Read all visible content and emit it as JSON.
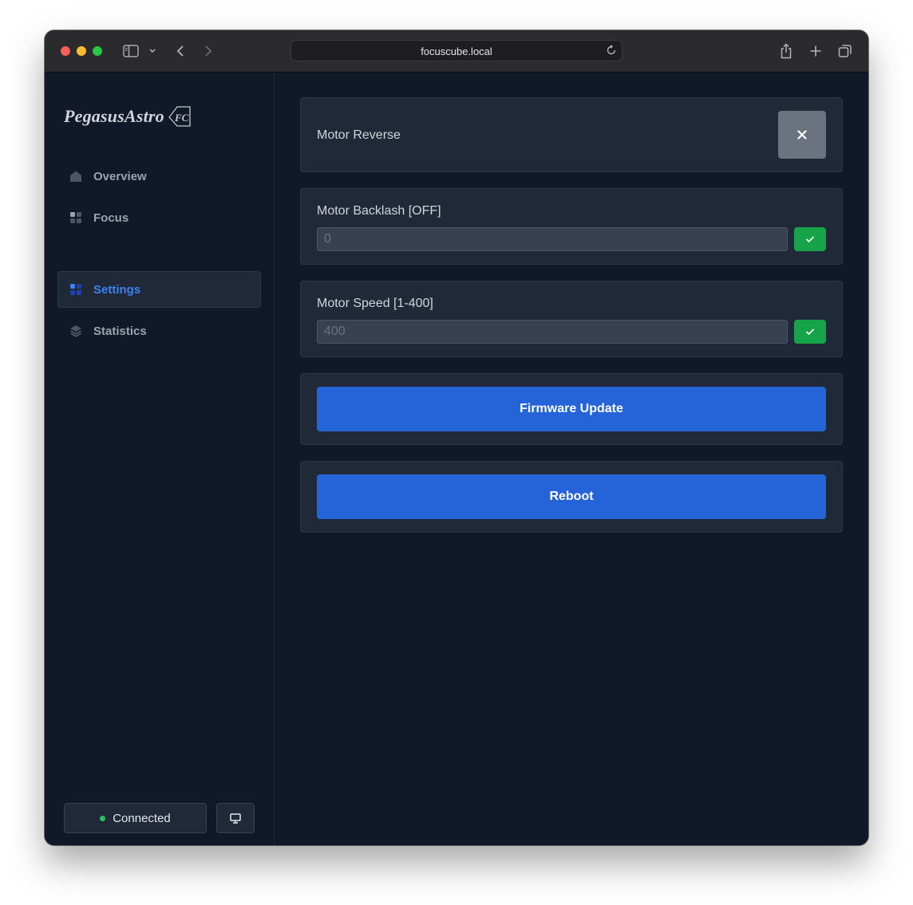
{
  "browser": {
    "url": "focuscube.local",
    "traffic_colors": {
      "close": "#ff5f57",
      "minimize": "#febc2e",
      "zoom": "#28c840"
    }
  },
  "sidebar": {
    "logo": {
      "main": "Pegasus",
      "second": "Astro",
      "badge": "FC"
    },
    "items": [
      {
        "label": "Overview",
        "icon": "home-icon",
        "active": false
      },
      {
        "label": "Focus",
        "icon": "grid-icon",
        "active": false
      },
      {
        "label": "Settings",
        "icon": "grid-icon",
        "active": true
      },
      {
        "label": "Statistics",
        "icon": "layers-icon",
        "active": false
      }
    ],
    "status": {
      "label": "Connected",
      "dot_color": "#22c55e"
    },
    "monitor_icon": "monitor-icon"
  },
  "settings": {
    "motor_reverse": {
      "label": "Motor Reverse",
      "toggle_icon": "close-icon"
    },
    "motor_backlash": {
      "label": "Motor Backlash [OFF]",
      "placeholder": "0",
      "apply_icon": "check-icon"
    },
    "motor_speed": {
      "label": "Motor Speed [1-400]",
      "placeholder": "400",
      "apply_icon": "check-icon"
    },
    "firmware_update": {
      "label": "Firmware Update"
    },
    "reboot": {
      "label": "Reboot"
    }
  },
  "colors": {
    "accent": "#3b82f6",
    "primary_button": "#2563d8",
    "success": "#16a34a",
    "toggle_off": "#6b7280"
  }
}
